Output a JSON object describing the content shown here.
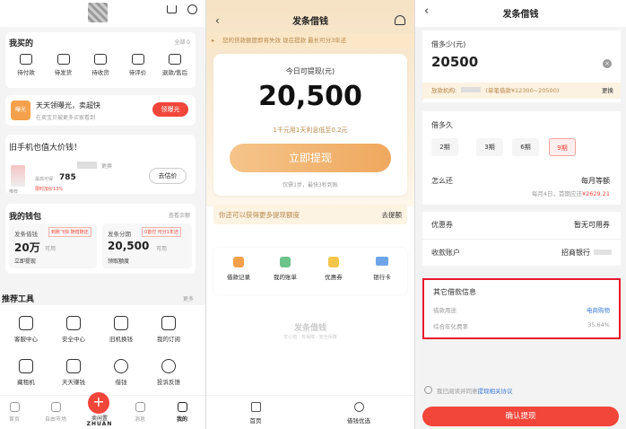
{
  "p1": {
    "mine": "我买的",
    "all": "全部 0",
    "orders": [
      "待付款",
      "待发货",
      "待收货",
      "待评价",
      "退款/售后"
    ],
    "promo_title": "天天领曝光，卖超快",
    "promo_sub": "在卖宝贝被更多买家看到",
    "promo_btn": "领曝光",
    "promo_tag": "曝光",
    "phone_title": "旧手机也值大价钱！",
    "phone_more": "更换",
    "phone_price": "785",
    "phone_high": "最高可得",
    "phone_rec": "推荐",
    "phone_limit": "限时加价13%",
    "phone_btn": "去估价",
    "wallet": "我的钱包",
    "wallet_more": "查看余额",
    "w1_label": "发条借钱",
    "w1_tag": "到账飞快 随借随还",
    "w1_amount": "20万",
    "w1_unit": "可用",
    "w1_action": "立即提现",
    "w2_label": "发条分期",
    "w2_tag": "0首付 可分1年还",
    "w2_amount": "20,500",
    "w2_unit": "可用",
    "w2_action": "领取额度",
    "tools_title": "推荐工具",
    "tools_more": "更多",
    "tools": [
      "客服中心",
      "安全中心",
      "旧机换钱",
      "我的订阅",
      "藏租机",
      "天天赚钱",
      "借钱",
      "投诉反馈"
    ],
    "tabs": [
      "首页",
      "自由市场",
      "卖闲置",
      "消息",
      "我的"
    ],
    "tab_badge": "WEI",
    "brand": "ZHUAN"
  },
  "p2": {
    "title": "发条借钱",
    "notice": "您的贷款额度即将失效 现在提款 最长可分3年还",
    "card_title": "今日可提现(元)",
    "amount": "20,500",
    "rate": "1千元用1天利息低至0.2元",
    "cta": "立即提现",
    "cta_sub": "仅需1步，最快3秒到账",
    "extra": "你还可以获得更多提现额度",
    "extra_link": "去提额",
    "icons": [
      "借款记录",
      "我的账单",
      "优惠券",
      "银行卡"
    ],
    "brand": "发条借钱",
    "brand_sub": "安心借 · 有保障 · 安全保障",
    "tabs": [
      "首页",
      "借钱优选"
    ]
  },
  "p3": {
    "title": "发条借钱",
    "how_much": "借多少(元)",
    "amount": "20500",
    "org": "放款机构:",
    "org_detail": "(单笔借款¥12300~20500)",
    "change": "更换",
    "how_long": "借多久",
    "terms": [
      "2期",
      "3期",
      "6期",
      "9期"
    ],
    "how_repay": "怎么还",
    "repay_val": "每月等额",
    "repay_detail": "每月4日，首期应还",
    "repay_amt": "¥2629.21",
    "coupon": "优惠券",
    "coupon_val": "暂无可用券",
    "account": "收款账户",
    "account_val": "招商银行",
    "other": "其它借款信息",
    "purpose": "借款用途",
    "purpose_val": "电商购物",
    "apr": "综合年化费率",
    "apr_val": "35.64%",
    "agree": "我已阅读并同意",
    "agree_link": "提现相关协议",
    "confirm": "确认提现"
  },
  "colors": {
    "accent": "#f2463a",
    "gold": "#f0b66a",
    "highlight": "#e8192c",
    "link": "#3a7bd5"
  }
}
